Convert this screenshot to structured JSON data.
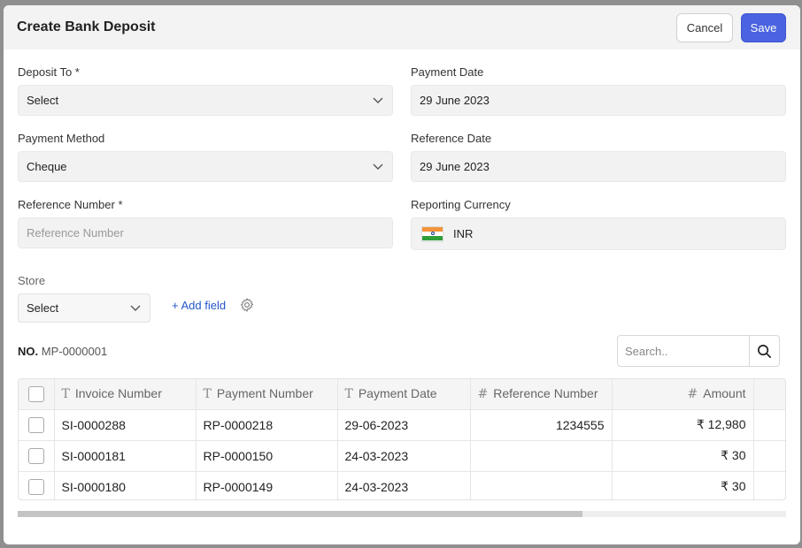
{
  "header": {
    "title": "Create Bank Deposit",
    "cancel_label": "Cancel",
    "save_label": "Save"
  },
  "form": {
    "deposit_to": {
      "label": "Deposit To *",
      "value": "Select"
    },
    "payment_date": {
      "label": "Payment Date",
      "value": "29 June 2023"
    },
    "payment_method": {
      "label": "Payment Method",
      "value": "Cheque"
    },
    "reference_date": {
      "label": "Reference Date",
      "value": "29 June 2023"
    },
    "reference_number": {
      "label": "Reference Number *",
      "placeholder": "Reference Number"
    },
    "reporting_currency": {
      "label": "Reporting Currency",
      "value": "INR"
    },
    "store": {
      "label": "Store",
      "value": "Select"
    },
    "add_field_label": "+ Add field"
  },
  "doc": {
    "no_label": "NO.",
    "no_value": "MP-0000001"
  },
  "search": {
    "placeholder": "Search.."
  },
  "table": {
    "columns": [
      "Invoice Number",
      "Payment Number",
      "Payment Date",
      "Reference Number",
      "Amount"
    ],
    "rows": [
      [
        "SI-0000288",
        "RP-0000218",
        "29-06-2023",
        "1234555",
        "₹ 12,980"
      ],
      [
        "SI-0000181",
        "RP-0000150",
        "24-03-2023",
        "",
        "₹ 30"
      ],
      [
        "SI-0000180",
        "RP-0000149",
        "24-03-2023",
        "",
        "₹ 30"
      ]
    ]
  },
  "colors": {
    "primary": "#4a63e0",
    "link": "#2356c9"
  }
}
